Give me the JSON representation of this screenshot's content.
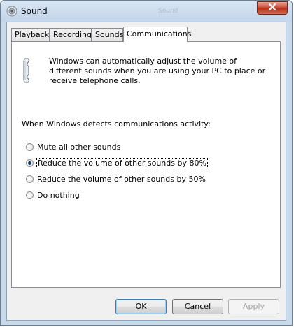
{
  "window": {
    "title": "Sound",
    "ghost_title": "Sound"
  },
  "tabs": [
    {
      "label": "Playback"
    },
    {
      "label": "Recording"
    },
    {
      "label": "Sounds"
    },
    {
      "label": "Communications"
    }
  ],
  "active_tab": "Communications",
  "communications": {
    "description": "Windows can automatically adjust the volume of different sounds when you are using your PC to place or receive telephone calls.",
    "detect_label": "When Windows detects communications activity:",
    "options": [
      {
        "label": "Mute all other sounds",
        "checked": false
      },
      {
        "label": "Reduce the volume of other sounds by 80%",
        "checked": true
      },
      {
        "label": "Reduce the volume of other sounds by 50%",
        "checked": false
      },
      {
        "label": "Do nothing",
        "checked": false
      }
    ]
  },
  "buttons": {
    "ok": "OK",
    "cancel": "Cancel",
    "apply": "Apply"
  },
  "icons": {
    "title": "speaker-icon",
    "close": "close-icon",
    "phone": "telephone-icon"
  },
  "colors": {
    "close_button": "#c44530",
    "frame": "#c9d9ec",
    "selected_dot": "#1a3a63"
  }
}
